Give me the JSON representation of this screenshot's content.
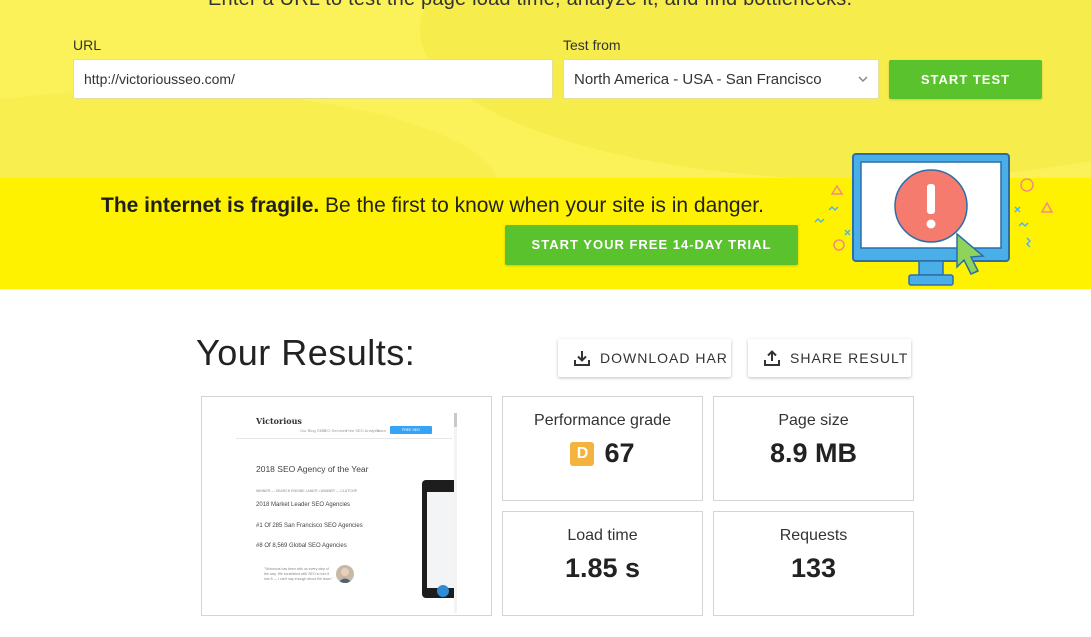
{
  "header": {
    "headline": "Enter a URL to test the page load time, analyze it, and find bottlenecks."
  },
  "form": {
    "url_label": "URL",
    "url_value": "http://victoriousseo.com/",
    "test_from_label": "Test from",
    "test_from_value": "North America - USA - San Francisco",
    "start_button": "START TEST"
  },
  "promo": {
    "bold_text": "The internet is fragile.",
    "text": " Be the first to know when your site is in danger.",
    "trial_button": "START YOUR FREE 14-DAY TRIAL"
  },
  "results": {
    "title": "Your Results:",
    "download_button": "DOWNLOAD HAR",
    "share_button": "SHARE RESULT",
    "metrics": {
      "performance": {
        "label": "Performance grade",
        "grade": "D",
        "value": "67"
      },
      "page_size": {
        "label": "Page size",
        "value": "8.9 MB"
      },
      "load_time": {
        "label": "Load time",
        "value": "1.85 s"
      },
      "requests": {
        "label": "Requests",
        "value": "133"
      }
    }
  },
  "thumbnail": {
    "logo": "Victorious",
    "nav": [
      "Our Blog SEO",
      "SEO Services",
      "Free SEO Analysis",
      "Team"
    ],
    "cta": "FREE SEO CONSULTATION",
    "heading": "2018 SEO Agency of the Year",
    "subline": "WINNER — SEARCH ENGINE LAND® • WINNER — CLUTCH®",
    "awards": [
      "2018 Market Leader SEO Agencies",
      "#1 Of 285 San Francisco SEO Agencies",
      "#8 Of 8,569 Global SEO Agencies"
    ],
    "quote": "\"Victorious has been with us every step of the way. We scrambled with SEO to turn it into 5 — I can't say enough about the team.\""
  },
  "colors": {
    "top_band": "#fbf158",
    "promo_band": "#fef200",
    "accent_green": "#5ac22c",
    "grade_badge": "#f4b23e"
  }
}
